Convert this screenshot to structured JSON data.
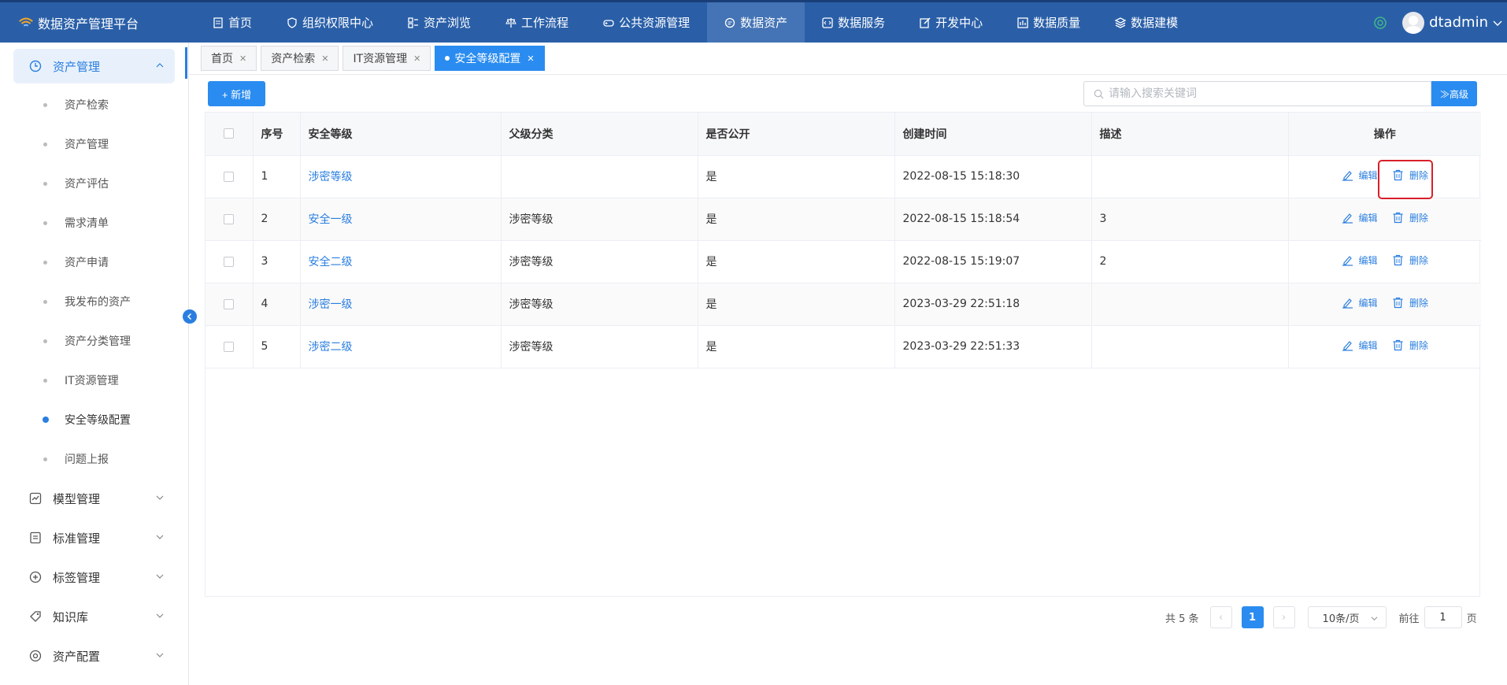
{
  "app": {
    "title": "数据资产管理平台",
    "user": "dtadmin"
  },
  "nav": [
    {
      "label": "首页",
      "icon": "document-icon"
    },
    {
      "label": "组织权限中心",
      "icon": "shield-icon"
    },
    {
      "label": "资产浏览",
      "icon": "grid-list-icon"
    },
    {
      "label": "工作流程",
      "icon": "scale-icon"
    },
    {
      "label": "公共资源管理",
      "icon": "gamepad-icon"
    },
    {
      "label": "数据资产",
      "icon": "chat-icon"
    },
    {
      "label": "数据服务",
      "icon": "code-icon"
    },
    {
      "label": "开发中心",
      "icon": "edit-icon"
    },
    {
      "label": "数据质量",
      "icon": "bar-chart-icon"
    },
    {
      "label": "数据建模",
      "icon": "layers-icon"
    }
  ],
  "sidebar": {
    "groups": [
      {
        "label": "资产管理",
        "icon": "clock-icon"
      },
      {
        "label": "模型管理",
        "icon": "line-chart-icon"
      },
      {
        "label": "标准管理",
        "icon": "list-doc-icon"
      },
      {
        "label": "标签管理",
        "icon": "plus-circle-icon"
      },
      {
        "label": "知识库",
        "icon": "tag-icon"
      },
      {
        "label": "资产配置",
        "icon": "settings-icon"
      }
    ],
    "items": [
      {
        "label": "资产检索"
      },
      {
        "label": "资产管理"
      },
      {
        "label": "资产评估"
      },
      {
        "label": "需求清单"
      },
      {
        "label": "资产申请"
      },
      {
        "label": "我发布的资产"
      },
      {
        "label": "资产分类管理"
      },
      {
        "label": "IT资源管理"
      },
      {
        "label": "安全等级配置"
      },
      {
        "label": "问题上报"
      }
    ]
  },
  "tabs": [
    {
      "label": "首页"
    },
    {
      "label": "资产检索"
    },
    {
      "label": "IT资源管理"
    },
    {
      "label": "安全等级配置"
    }
  ],
  "toolbar": {
    "add_label": "+ 新增",
    "search_placeholder": "请输入搜索关键词",
    "advanced_label": "≫高级"
  },
  "table": {
    "headers": [
      "序号",
      "安全等级",
      "父级分类",
      "是否公开",
      "创建时间",
      "描述",
      "操作"
    ],
    "rows": [
      {
        "no": "1",
        "level": "涉密等级",
        "parent": "",
        "public": "是",
        "created": "2022-08-15 15:18:30",
        "desc": ""
      },
      {
        "no": "2",
        "level": "安全一级",
        "parent": "涉密等级",
        "public": "是",
        "created": "2022-08-15 15:18:54",
        "desc": "3"
      },
      {
        "no": "3",
        "level": "安全二级",
        "parent": "涉密等级",
        "public": "是",
        "created": "2022-08-15 15:19:07",
        "desc": "2"
      },
      {
        "no": "4",
        "level": "涉密一级",
        "parent": "涉密等级",
        "public": "是",
        "created": "2023-03-29 22:51:18",
        "desc": ""
      },
      {
        "no": "5",
        "level": "涉密二级",
        "parent": "涉密等级",
        "public": "是",
        "created": "2023-03-29 22:51:33",
        "desc": ""
      }
    ],
    "edit_label": "编辑",
    "delete_label": "删除"
  },
  "pagination": {
    "total_text": "共 5 条",
    "current_page": "1",
    "page_size": "10条/页",
    "goto_prefix": "前往",
    "goto_value": "1",
    "goto_suffix": "页"
  },
  "colors": {
    "nav_bg": "#2a5fa8",
    "accent": "#2a8cf0",
    "highlight": "#d8202a"
  }
}
